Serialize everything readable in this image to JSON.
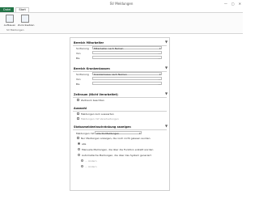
{
  "window": {
    "title": "SV Meldungen",
    "min": "—",
    "max": "▢",
    "close": "✕"
  },
  "tabs": {
    "file": "Datei",
    "start": "Start"
  },
  "ribbon": {
    "buttons": [
      {
        "label": "Aufbauen"
      },
      {
        "label": "Zurücksetzen"
      }
    ],
    "group_name": "SV Meldungen"
  },
  "sections": {
    "period": {
      "title": "Bereich Mitarbeiter",
      "sort_label": "Sortierung",
      "sort_value": "Mitarbeiter nach Namen",
      "from_label": "Von",
      "to_label": "Bis"
    },
    "insurance": {
      "title": "Bereich Krankenkassen",
      "sort_label": "Sortierung",
      "sort_value": "Krankenkasse nach Namen",
      "from_label": "Von",
      "to_label": "Bis"
    },
    "special": {
      "title": "Zeitraum (Nicht Verarbeitet)",
      "checkbox_label": "Zeitraum beachten"
    },
    "selection": {
      "title": "Auswahl",
      "option1": "Meldungen zum auswerten",
      "option2": "Meldungen mit Verarbeitungen"
    },
    "status": {
      "title": "Statusmeldeeinschränkung anzeigen",
      "filter_label": "Meldungen mit",
      "filter_value": "Alle SV-Meldungen",
      "checkbox_all": "Nur Meldungen anzeigen, die noch nicht gelesen wurden",
      "radio_all": "alle",
      "radio_manual": "Manuelle Meldungen, die über die Funktion erstellt worden",
      "radio_auto": "Automatische Meldungen, die über das System generiert",
      "sub1": "… ändern",
      "sub2": "… ändern"
    }
  },
  "icons": {
    "funnel": "▼"
  }
}
